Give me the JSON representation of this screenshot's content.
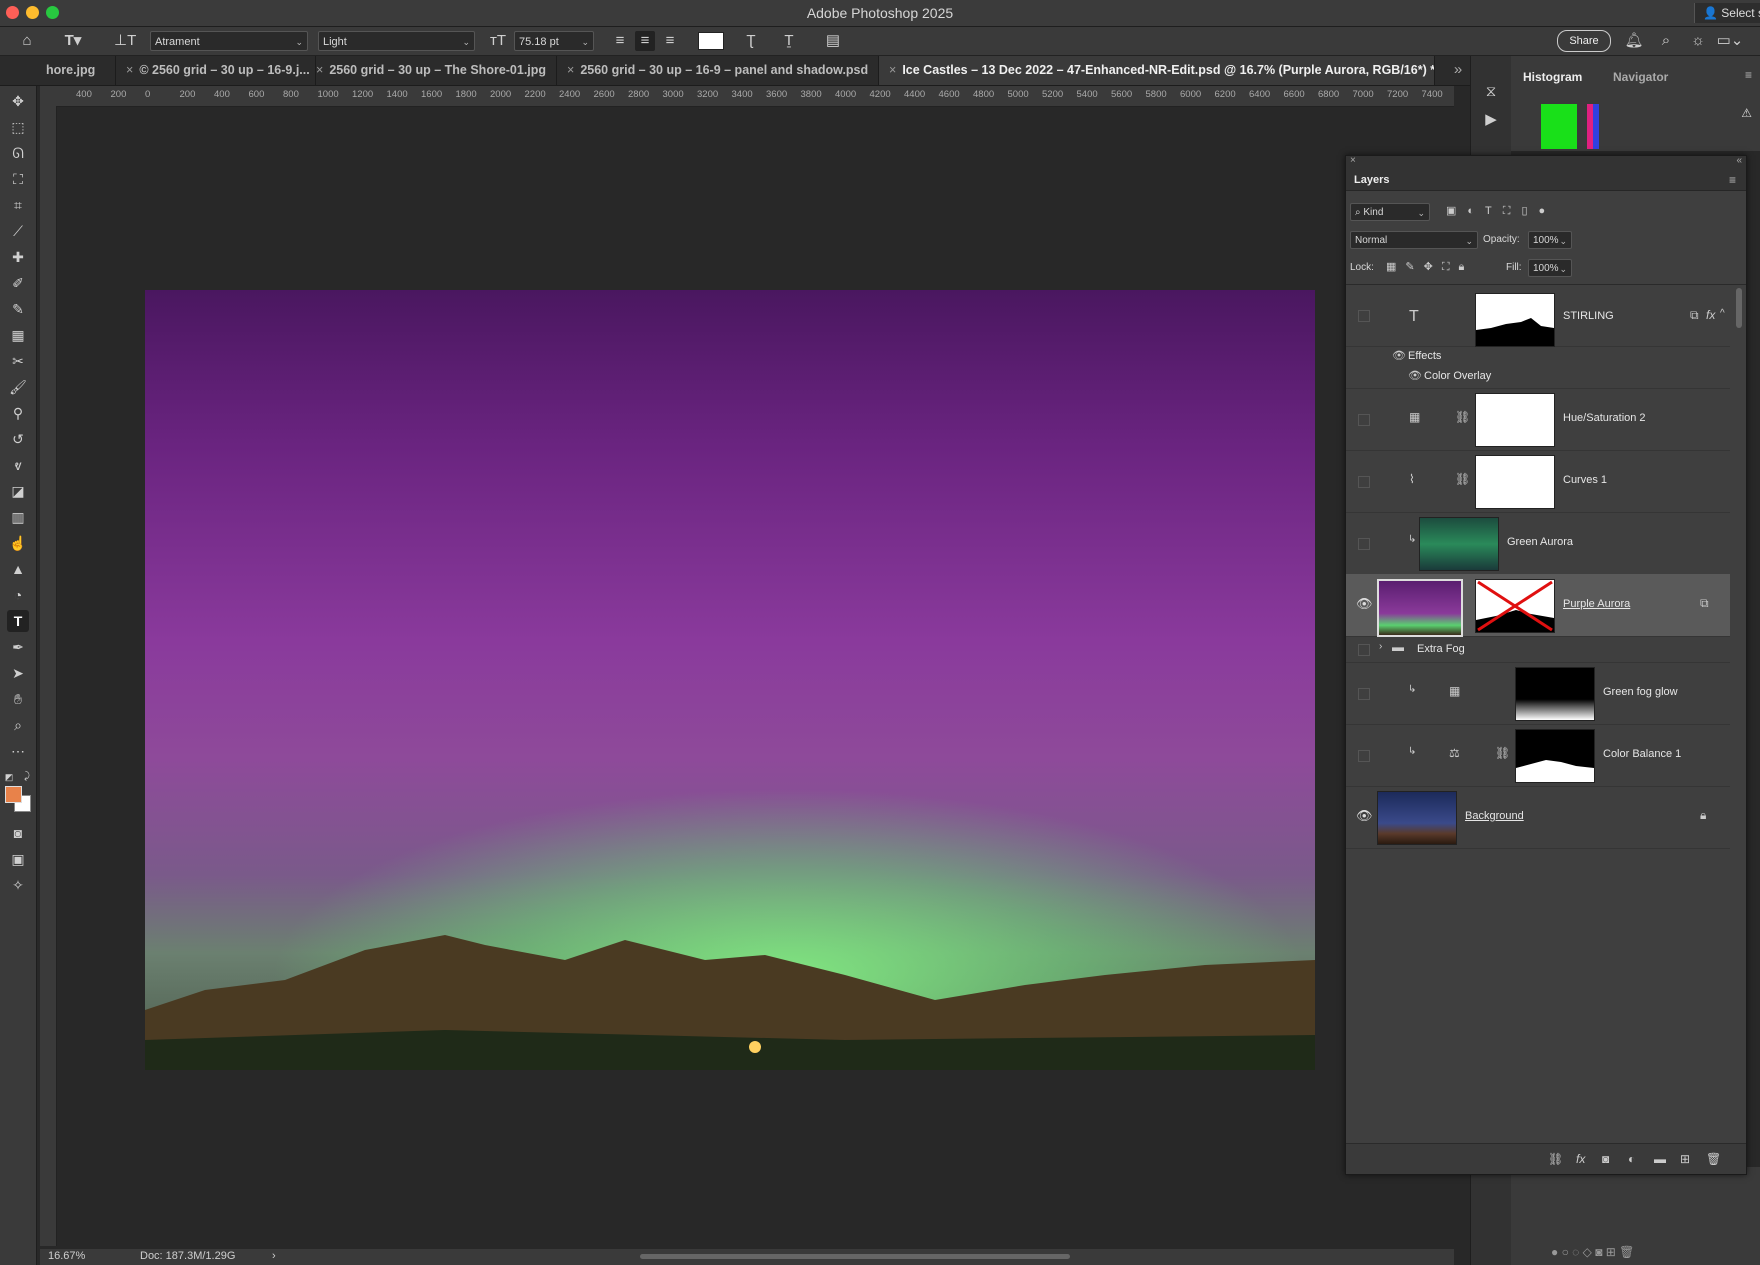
{
  "window": {
    "title": "Adobe Photoshop 2025",
    "select_label": "Select s"
  },
  "options_bar": {
    "font_family": "Atrament",
    "font_style": "Light",
    "font_size": "75.18 pt",
    "share_label": "Share"
  },
  "tabs": [
    {
      "label": "hore.jpg"
    },
    {
      "label": "© 2560 grid – 30 up – 16-9.j..."
    },
    {
      "label": "2560 grid – 30 up – The Shore-01.jpg"
    },
    {
      "label": "2560 grid – 30 up – 16-9 – panel and shadow.psd"
    },
    {
      "label": "Ice Castles – 13 Dec 2022 – 47-Enhanced-NR-Edit.psd @ 16.7% (Purple Aurora, RGB/16*) *"
    }
  ],
  "ruler": {
    "labels": [
      "400",
      "200",
      "0",
      "200",
      "400",
      "600",
      "800",
      "1000",
      "1200",
      "1400",
      "1600",
      "1800",
      "2000",
      "2200",
      "2400",
      "2600",
      "2800",
      "3000",
      "3200",
      "3400",
      "3600",
      "3800",
      "4000",
      "4200",
      "4400",
      "4600",
      "4800",
      "5000",
      "5200",
      "5400",
      "5600",
      "5800",
      "6000",
      "6200",
      "6400",
      "6600",
      "6800",
      "7000",
      "7200",
      "7400",
      "7600"
    ]
  },
  "status": {
    "zoom": "16.67%",
    "doc": "Doc: 187.3M/1.29G"
  },
  "histogram_panel": {
    "tab1": "Histogram",
    "tab2": "Navigator"
  },
  "layers_panel": {
    "title": "Layers",
    "filter": "Kind",
    "blend_mode": "Normal",
    "opacity_label": "Opacity:",
    "opacity_value": "100%",
    "lock_label": "Lock:",
    "fill_label": "Fill:",
    "fill_value": "100%",
    "layers": [
      {
        "name": "STIRLING",
        "type": "text",
        "visible": false
      },
      {
        "name": "Effects",
        "type": "effects-header"
      },
      {
        "name": "Color Overlay",
        "type": "effect"
      },
      {
        "name": "Hue/Saturation 2",
        "type": "adjustment",
        "visible": false
      },
      {
        "name": "Curves 1",
        "type": "adjustment",
        "visible": false
      },
      {
        "name": "Green Aurora",
        "type": "pixel",
        "visible": false
      },
      {
        "name": "Purple Aurora",
        "type": "pixel",
        "visible": true,
        "selected": true
      },
      {
        "name": "Extra Fog",
        "type": "group",
        "visible": false
      },
      {
        "name": "Green fog glow",
        "type": "adjustment",
        "visible": false
      },
      {
        "name": "Color Balance 1",
        "type": "adjustment",
        "visible": false
      },
      {
        "name": "Background",
        "type": "pixel",
        "visible": true,
        "locked": true
      }
    ]
  },
  "colors": {
    "foreground": "#e8824a",
    "background": "#ffffff",
    "accent": "#5a5a5a"
  }
}
